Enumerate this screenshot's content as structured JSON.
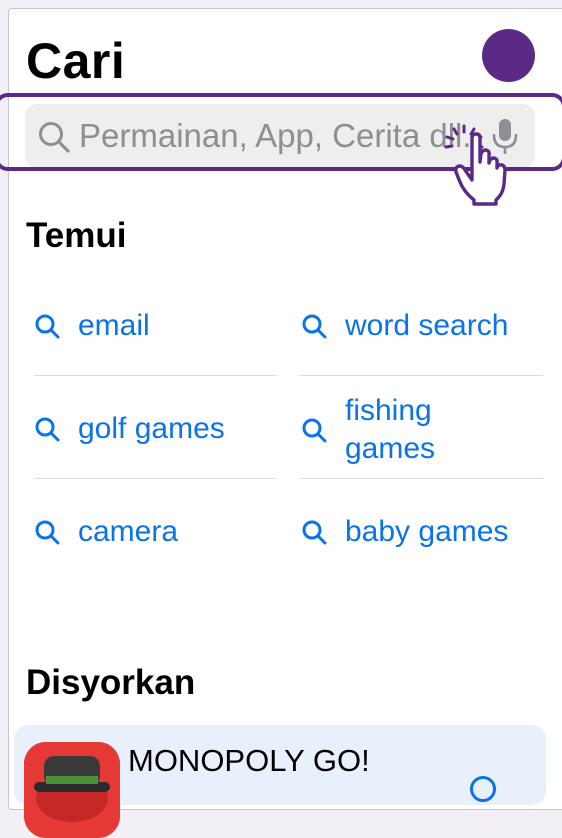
{
  "header": {
    "title": "Cari"
  },
  "search": {
    "placeholder": "Permainan, App, Cerita dll."
  },
  "discover": {
    "title": "Temui",
    "items": [
      {
        "label": "email"
      },
      {
        "label": "word search"
      },
      {
        "label": "golf games"
      },
      {
        "label": "fishing games"
      },
      {
        "label": "camera"
      },
      {
        "label": "baby games"
      }
    ]
  },
  "suggested": {
    "title": "Disyorkan",
    "app": {
      "name": "MONOPOLY GO!"
    }
  },
  "colors": {
    "accent": "#0a73ea",
    "highlight": "#5a2a86"
  },
  "icons": [
    "search-icon",
    "microphone-icon",
    "hand-pointer-icon",
    "tap-burst-icon",
    "avatar"
  ]
}
